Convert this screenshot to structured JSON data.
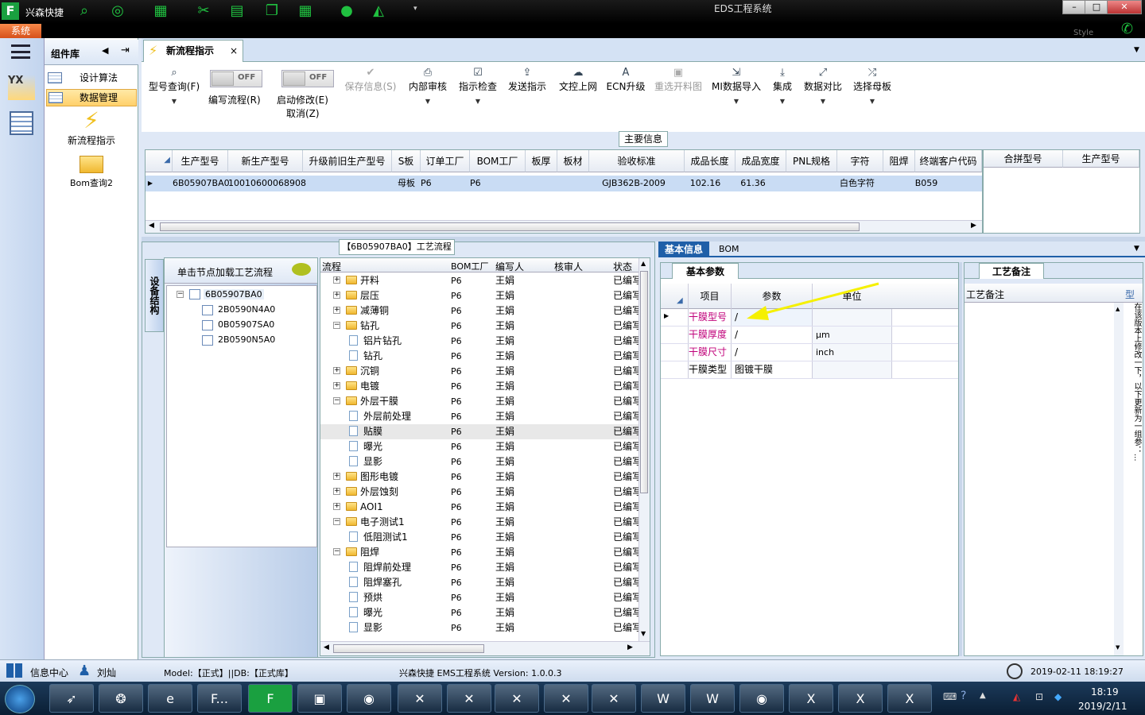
{
  "window": {
    "app_name": "兴森快捷",
    "title": "EDS工程系统",
    "system_tab": "系统",
    "style_label": "Style",
    "controls": [
      "–",
      "□",
      "✕"
    ]
  },
  "sidebar": {
    "panel_title": "组件库",
    "items": [
      {
        "label": "设计算法",
        "icon": "table-icon"
      },
      {
        "label": "数据管理",
        "icon": "table-icon"
      }
    ],
    "big_items": [
      {
        "label": "新流程指示",
        "icon": "lightning-icon"
      },
      {
        "label": "Bom查询2",
        "icon": "folder-open-icon"
      }
    ]
  },
  "doc_tab": {
    "label": "新流程指示",
    "close": "×"
  },
  "toolbar": {
    "model_query": "型号查询(F)",
    "edit_flow_toggle": "OFF",
    "edit_flow": "编写流程(R)",
    "start_edit_toggle": "OFF",
    "start_edit": "启动修改(E)",
    "cancel": "取消(Z)",
    "save_info": "保存信息(S)",
    "internal_review": "内部审核",
    "instr_check": "指示检查",
    "send_instr": "发送指示",
    "upload": "文控上网",
    "ecn_upgrade": "ECN升级",
    "reselect_chart": "重选开料图",
    "mi_import": "MI数据导入",
    "integrate": "集成",
    "data_compare": "数据对比",
    "select_mother": "选择母板"
  },
  "main_info": {
    "title": "主要信息",
    "columns": [
      "生产型号",
      "新生产型号",
      "升级前旧生产型号",
      "S板",
      "订单工厂",
      "BOM工厂",
      "板厚",
      "板材",
      "验收标准",
      "成品长度",
      "成品宽度",
      "PNL规格",
      "字符",
      "阻焊",
      "终端客户代码"
    ],
    "row": [
      "6B05907BA0",
      "10010600068908",
      "",
      "母板",
      "P6",
      "P6",
      "",
      "",
      "GJB362B-2009",
      "102.16",
      "61.36",
      "",
      "白色字符",
      "",
      "B059"
    ],
    "side_columns": [
      "合拼型号",
      "生产型号"
    ]
  },
  "flow": {
    "title": "【6B05907BA0】工艺流程",
    "left_tab": "设备结构",
    "load_hint": "单击节点加载工艺流程",
    "tree": [
      {
        "label": "6B05907BA0",
        "children": [
          "2B0590N4A0",
          "0B05907SA0",
          "2B0590N5A0"
        ]
      }
    ],
    "columns": [
      "流程",
      "BOM工厂",
      "编写人",
      "核审人",
      "状态"
    ],
    "rows": [
      {
        "name": "开料",
        "level": 0,
        "type": "folder",
        "exp": "+",
        "bom": "P6",
        "writer": "王娟",
        "status": "已编写"
      },
      {
        "name": "层压",
        "level": 0,
        "type": "folder",
        "exp": "+",
        "bom": "P6",
        "writer": "王娟",
        "status": "已编写"
      },
      {
        "name": "减薄铜",
        "level": 0,
        "type": "folder",
        "exp": "+",
        "bom": "P6",
        "writer": "王娟",
        "status": "已编写"
      },
      {
        "name": "钻孔",
        "level": 0,
        "type": "folder",
        "exp": "-",
        "bom": "P6",
        "writer": "王娟",
        "status": "已编写"
      },
      {
        "name": "铝片钻孔",
        "level": 1,
        "type": "doc",
        "exp": "",
        "bom": "P6",
        "writer": "王娟",
        "status": "已编写"
      },
      {
        "name": "钻孔",
        "level": 1,
        "type": "doc",
        "exp": "",
        "bom": "P6",
        "writer": "王娟",
        "status": "已编写"
      },
      {
        "name": "沉铜",
        "level": 0,
        "type": "folder",
        "exp": "+",
        "bom": "P6",
        "writer": "王娟",
        "status": "已编写"
      },
      {
        "name": "电镀",
        "level": 0,
        "type": "folder",
        "exp": "+",
        "bom": "P6",
        "writer": "王娟",
        "status": "已编写"
      },
      {
        "name": "外层干膜",
        "level": 0,
        "type": "folder",
        "exp": "-",
        "bom": "P6",
        "writer": "王娟",
        "status": "已编写"
      },
      {
        "name": "外层前处理",
        "level": 1,
        "type": "doc",
        "exp": "",
        "bom": "P6",
        "writer": "王娟",
        "status": "已编写"
      },
      {
        "name": "贴膜",
        "level": 1,
        "type": "doc",
        "exp": "",
        "bom": "P6",
        "writer": "王娟",
        "status": "已编写"
      },
      {
        "name": "曝光",
        "level": 1,
        "type": "doc",
        "exp": "",
        "bom": "P6",
        "writer": "王娟",
        "status": "已编写"
      },
      {
        "name": "显影",
        "level": 1,
        "type": "doc",
        "exp": "",
        "bom": "P6",
        "writer": "王娟",
        "status": "已编写"
      },
      {
        "name": "图形电镀",
        "level": 0,
        "type": "folder",
        "exp": "+",
        "bom": "P6",
        "writer": "王娟",
        "status": "已编写"
      },
      {
        "name": "外层蚀刻",
        "level": 0,
        "type": "folder",
        "exp": "+",
        "bom": "P6",
        "writer": "王娟",
        "status": "已编写"
      },
      {
        "name": "AOI1",
        "level": 0,
        "type": "folder",
        "exp": "+",
        "bom": "P6",
        "writer": "王娟",
        "status": "已编写"
      },
      {
        "name": "电子测试1",
        "level": 0,
        "type": "folder",
        "exp": "-",
        "bom": "P6",
        "writer": "王娟",
        "status": "已编写"
      },
      {
        "name": "低阻测试1",
        "level": 1,
        "type": "doc",
        "exp": "",
        "bom": "P6",
        "writer": "王娟",
        "status": "已编写"
      },
      {
        "name": "阻焊",
        "level": 0,
        "type": "folder",
        "exp": "-",
        "bom": "P6",
        "writer": "王娟",
        "status": "已编写"
      },
      {
        "name": "阻焊前处理",
        "level": 1,
        "type": "doc",
        "exp": "",
        "bom": "P6",
        "writer": "王娟",
        "status": "已编写"
      },
      {
        "name": "阻焊塞孔",
        "level": 1,
        "type": "doc",
        "exp": "",
        "bom": "P6",
        "writer": "王娟",
        "status": "已编写"
      },
      {
        "name": "预烘",
        "level": 1,
        "type": "doc",
        "exp": "",
        "bom": "P6",
        "writer": "王娟",
        "status": "已编写"
      },
      {
        "name": "曝光",
        "level": 1,
        "type": "doc",
        "exp": "",
        "bom": "P6",
        "writer": "王娟",
        "status": "已编写"
      },
      {
        "name": "显影",
        "level": 1,
        "type": "doc",
        "exp": "",
        "bom": "P6",
        "writer": "王娟",
        "status": "已编写"
      }
    ]
  },
  "detail": {
    "tabs": [
      "基本信息",
      "BOM"
    ],
    "subtab": "基本参数",
    "columns": [
      "项目",
      "参数",
      "单位"
    ],
    "rows": [
      {
        "item": "干膜型号",
        "param": "/",
        "unit": "",
        "highlight": true
      },
      {
        "item": "干膜厚度",
        "param": "/",
        "unit": "μm",
        "highlight": true
      },
      {
        "item": "干膜尺寸",
        "param": "/",
        "unit": "inch",
        "highlight": true
      },
      {
        "item": "干膜类型",
        "param": "图镀干膜",
        "unit": "",
        "highlight": false
      }
    ],
    "note_tab": "工艺备注",
    "note_col": "工艺备注",
    "note_col2": "型",
    "vertical_text": "在该版本上修改一下，以下更新为一组参：..."
  },
  "status": {
    "info_center": "信息中心",
    "user": "刘灿",
    "model_db": "Model:【正式】||DB:【正式库】",
    "version": "兴森快捷 EMS工程系统 Version: 1.0.0.3",
    "datetime": "2019-02-11 18:19:27"
  },
  "taskbar": {
    "time": "18:19",
    "date": "2019/2/11",
    "app_label": "F..."
  },
  "colors": {
    "accent": "#1f5fa8",
    "highlight_text": "#c0007a",
    "selection": "#c9dcf4",
    "arrow": "#f5f000"
  }
}
